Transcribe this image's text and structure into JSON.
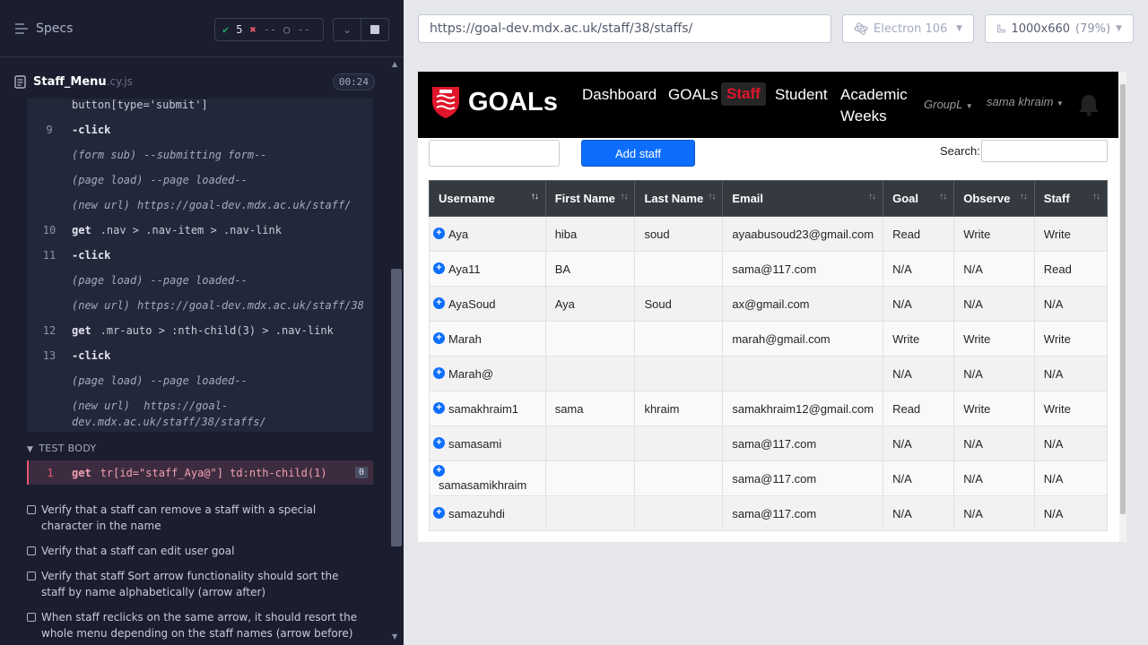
{
  "runner": {
    "specs_label": "Specs",
    "stats": {
      "passed": "5",
      "failed": "--",
      "pending": "--"
    },
    "file": {
      "name": "Staff_Menu",
      "ext": ".cy.js",
      "duration": "00:24"
    },
    "commands": [
      {
        "num": "",
        "name": "",
        "msg": "button[type='submit']",
        "kind": "cut"
      },
      {
        "num": "9",
        "name": "-click",
        "msg": "",
        "kind": "cmd"
      },
      {
        "num": "",
        "name": "(form sub)",
        "msg": "--submitting form--",
        "kind": "event"
      },
      {
        "num": "",
        "name": "(page load)",
        "msg": "--page loaded--",
        "kind": "event"
      },
      {
        "num": "",
        "name": "(new url)",
        "msg": "https://goal-dev.mdx.ac.uk/staff/",
        "kind": "event"
      },
      {
        "num": "10",
        "name": "get",
        "msg": ".nav > .nav-item > .nav-link",
        "kind": "cmd"
      },
      {
        "num": "11",
        "name": "-click",
        "msg": "",
        "kind": "cmd"
      },
      {
        "num": "",
        "name": "(page load)",
        "msg": "--page loaded--",
        "kind": "event"
      },
      {
        "num": "",
        "name": "(new url)",
        "msg": "https://goal-dev.mdx.ac.uk/staff/38",
        "kind": "event"
      },
      {
        "num": "12",
        "name": "get",
        "msg": ".mr-auto > :nth-child(3) > .nav-link",
        "kind": "cmd"
      },
      {
        "num": "13",
        "name": "-click",
        "msg": "",
        "kind": "cmd"
      },
      {
        "num": "",
        "name": "(page load)",
        "msg": "--page loaded--",
        "kind": "event"
      }
    ],
    "last_url": {
      "name": "(new url)",
      "line1": "https://goal-",
      "line2": "dev.mdx.ac.uk/staff/38/staffs/"
    },
    "test_body_label": "TEST BODY",
    "test_body": {
      "num": "1",
      "name": "get",
      "msg": "tr[id=\"staff_Aya@\"] td:nth-child(1)",
      "badge": "0"
    },
    "tests": [
      "Verify that a staff can remove a staff with a special character in the name",
      "Verify that a staff can edit user goal",
      "Verify that staff Sort arrow functionality should sort the staff by name alphabetically (arrow after)",
      "When staff reclicks on the same arrow, it should resort the whole menu depending on the staff names (arrow before)"
    ]
  },
  "toolbar": {
    "url": "https://goal-dev.mdx.ac.uk/staff/38/staffs/",
    "browser": "Electron 106",
    "viewport": "1000x660",
    "zoom": "(79%)"
  },
  "app": {
    "brand": "GOALs",
    "nav": {
      "dashboard": "Dashboard",
      "goals": "GOALs",
      "staff": "Staff",
      "student": "Student",
      "academic_1": "Academic",
      "academic_2": "Weeks",
      "group": "GroupL",
      "user": "sama khraim"
    },
    "add_staff": "Add staff",
    "search_label": "Search:",
    "columns": [
      "Username",
      "First Name",
      "Last Name",
      "Email",
      "Goal",
      "Observe",
      "Staff"
    ],
    "rows": [
      [
        "Aya",
        "hiba",
        "soud",
        "ayaabusoud23@gmail.com",
        "Read",
        "Write",
        "Write"
      ],
      [
        "Aya11",
        "BA",
        "",
        "sama@117.com",
        "N/A",
        "N/A",
        "Read"
      ],
      [
        "AyaSoud",
        "Aya",
        "Soud",
        "ax@gmail.com",
        "N/A",
        "N/A",
        "N/A"
      ],
      [
        "Marah",
        "",
        "",
        "marah@gmail.com",
        "Write",
        "Write",
        "Write"
      ],
      [
        "Marah@",
        "",
        "",
        "",
        "N/A",
        "N/A",
        "N/A"
      ],
      [
        "samakhraim1",
        "sama",
        "khraim",
        "samakhraim12@gmail.com",
        "Read",
        "Write",
        "Write"
      ],
      [
        "samasami",
        "",
        "",
        "sama@117.com",
        "N/A",
        "N/A",
        "N/A"
      ],
      [
        "samasamikhraim",
        "",
        "",
        "sama@117.com",
        "N/A",
        "N/A",
        "N/A"
      ],
      [
        "samazuhdi",
        "",
        "",
        "sama@117.com",
        "N/A",
        "N/A",
        "N/A"
      ]
    ]
  }
}
